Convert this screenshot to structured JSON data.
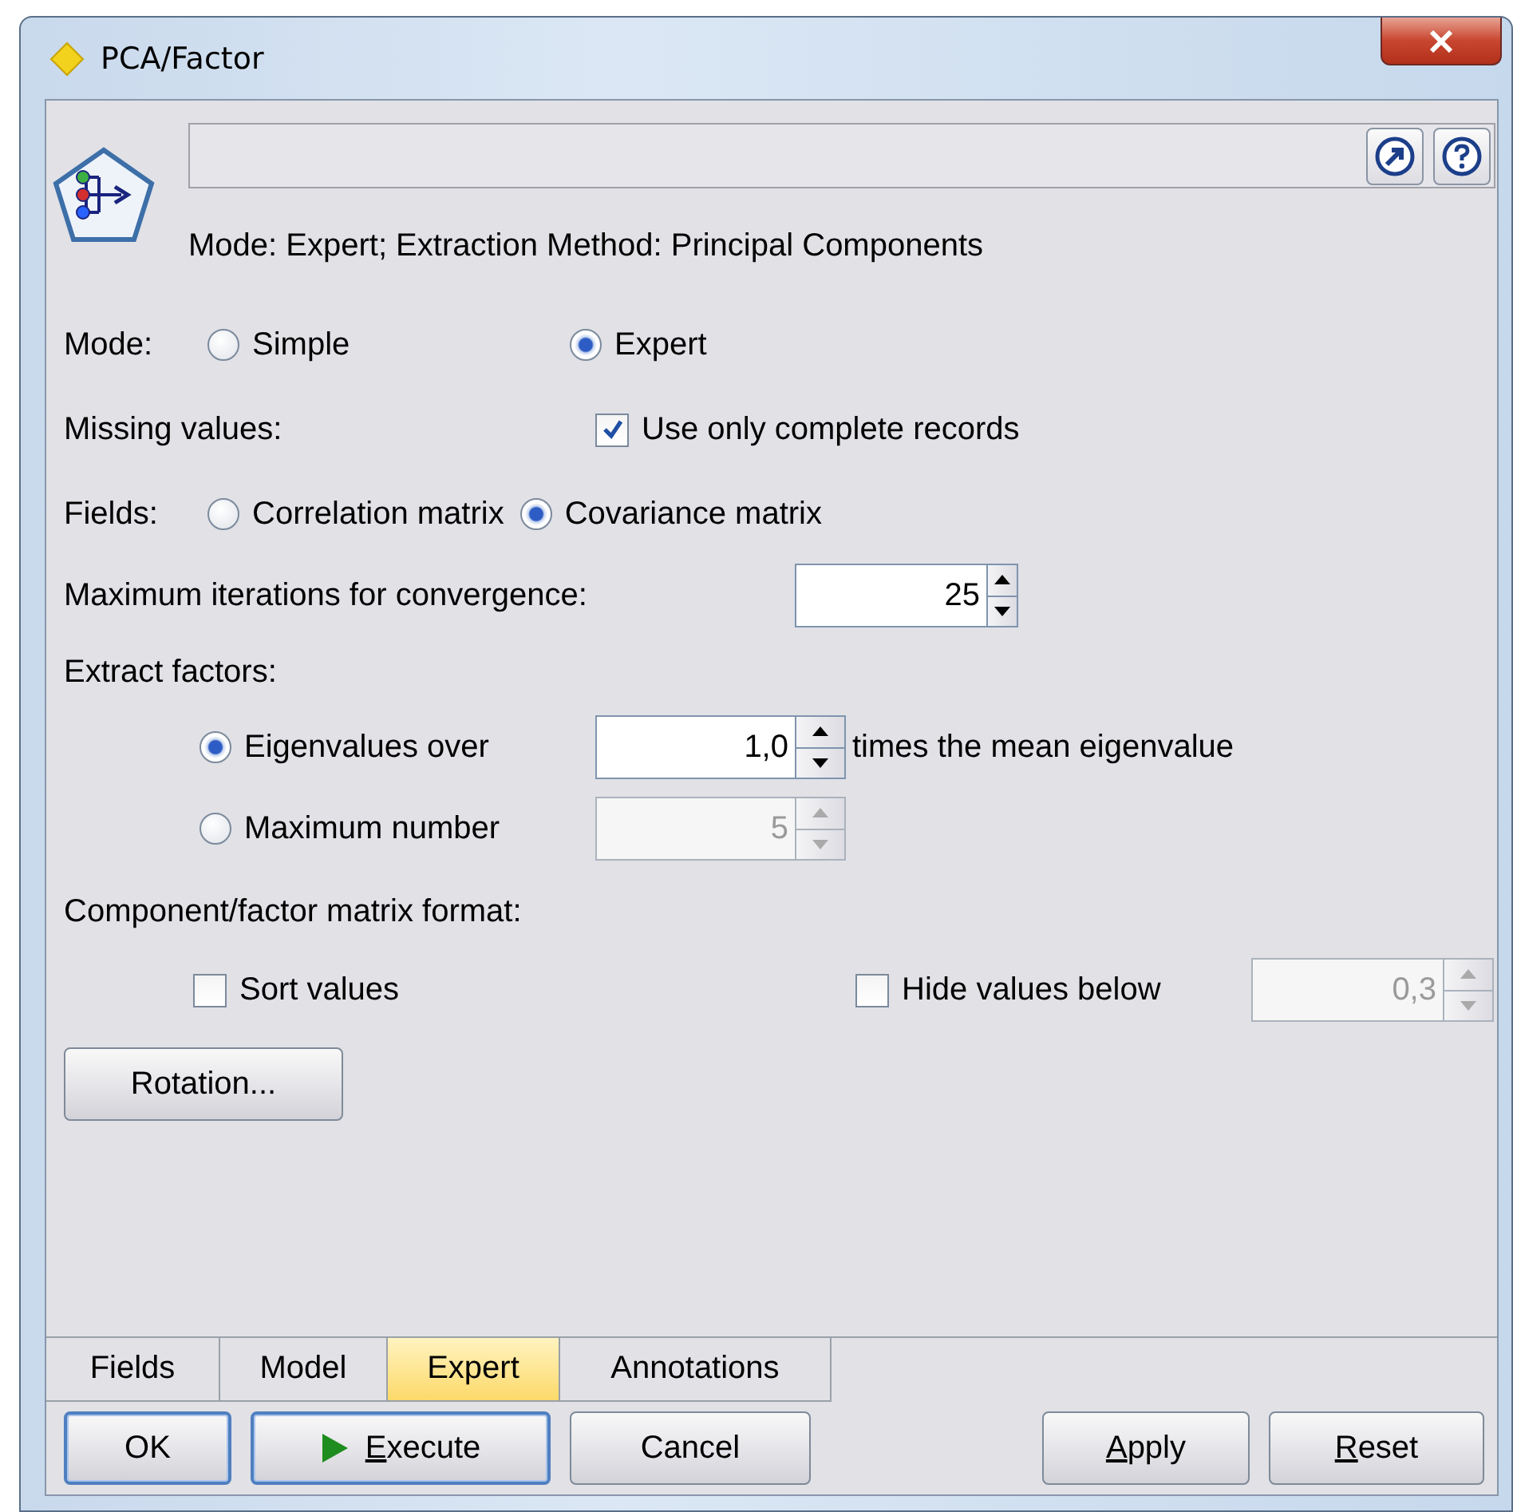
{
  "window": {
    "title": "PCA/Factor"
  },
  "header": {
    "description": "Mode: Expert; Extraction Method: Principal Components"
  },
  "mode": {
    "label": "Mode:",
    "options": [
      {
        "label": "Simple",
        "selected": false
      },
      {
        "label": "Expert",
        "selected": true
      }
    ]
  },
  "missing_values": {
    "label": "Missing values:",
    "checkbox": {
      "label": "Use only complete records",
      "checked": true
    }
  },
  "fields": {
    "label": "Fields:",
    "options": [
      {
        "label": "Correlation matrix",
        "selected": false
      },
      {
        "label": "Covariance matrix",
        "selected": true
      }
    ]
  },
  "max_iterations": {
    "label": "Maximum iterations for convergence:",
    "value": "25",
    "disabled": false
  },
  "extract_factors": {
    "label": "Extract factors:",
    "options": [
      {
        "label": "Eigenvalues over",
        "selected": true,
        "value": "1,0",
        "disabled": false,
        "suffix": "times the mean eigenvalue"
      },
      {
        "label": "Maximum number",
        "selected": false,
        "value": "5",
        "disabled": true
      }
    ]
  },
  "matrix_format": {
    "label": "Component/factor matrix format:",
    "sort": {
      "label": "Sort values",
      "checked": false
    },
    "hide": {
      "label": "Hide values below",
      "checked": false,
      "value": "0,3",
      "disabled": true
    }
  },
  "rotation_button": {
    "label": "Rotation..."
  },
  "tabs": [
    {
      "label": "Fields",
      "selected": false
    },
    {
      "label": "Model",
      "selected": false
    },
    {
      "label": "Expert",
      "selected": true
    },
    {
      "label": "Annotations",
      "selected": false
    }
  ],
  "buttons": [
    {
      "label": "OK",
      "kind": "plain",
      "emphasized": true,
      "underline_first": false
    },
    {
      "label": "Execute",
      "kind": "run",
      "emphasized": true,
      "underline_first": true
    },
    {
      "label": "Cancel",
      "kind": "plain",
      "emphasized": false,
      "underline_first": false
    },
    {
      "label": "Apply",
      "kind": "plain",
      "emphasized": false,
      "underline_first": true
    },
    {
      "label": "Reset",
      "kind": "plain",
      "emphasized": false,
      "underline_first": true
    }
  ]
}
